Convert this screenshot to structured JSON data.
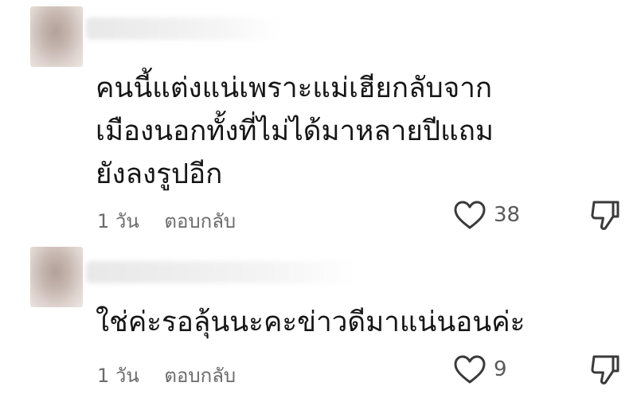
{
  "comments": [
    {
      "text": "คนนี้แต่งแน่เพราะแม่เฮียกลับจาก\nเมืองนอกทั้งที่ไม่ได้มาหลายปีแถม\nยังลงรูปอีก",
      "time": "1 วัน",
      "reply_label": "ตอบกลับ",
      "likes": "38",
      "like_icon": "heart-outline",
      "dislike_icon": "thumbs-down-outline"
    },
    {
      "text": "ใช่ค่ะรอลุ้นนะคะข่าวดีมาแน่นอนค่ะ",
      "time": "1 วัน",
      "reply_label": "ตอบกลับ",
      "likes": "9",
      "like_icon": "heart-outline",
      "dislike_icon": "thumbs-down-outline"
    }
  ],
  "colors": {
    "text": "#161616",
    "meta": "#6b6b6b",
    "icon": "#3a3a3a"
  }
}
